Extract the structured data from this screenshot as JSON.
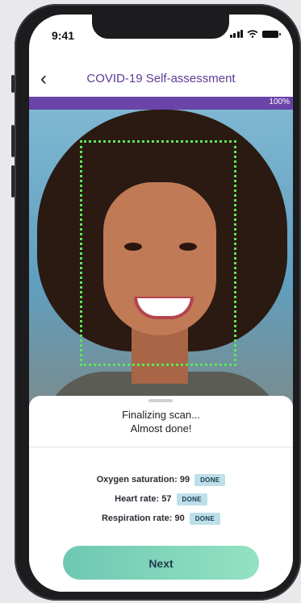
{
  "status_bar": {
    "time": "9:41"
  },
  "header": {
    "back_label": "‹",
    "title": "COVID-19 Self-assessment"
  },
  "progress": {
    "value_percent": 100,
    "label": "100%"
  },
  "sheet": {
    "status_line1": "Finalizing scan...",
    "status_line2": "Almost done!",
    "metrics": [
      {
        "label": "Oxygen saturation: 99",
        "badge": "DONE"
      },
      {
        "label": "Heart rate: 57",
        "badge": "DONE"
      },
      {
        "label": "Respiration rate: 90",
        "badge": "DONE"
      }
    ],
    "next_label": "Next"
  },
  "colors": {
    "accent": "#6a44a8",
    "scan_box": "#5ee65a",
    "button": "#80d6bb",
    "badge_bg": "#bde0e8"
  }
}
